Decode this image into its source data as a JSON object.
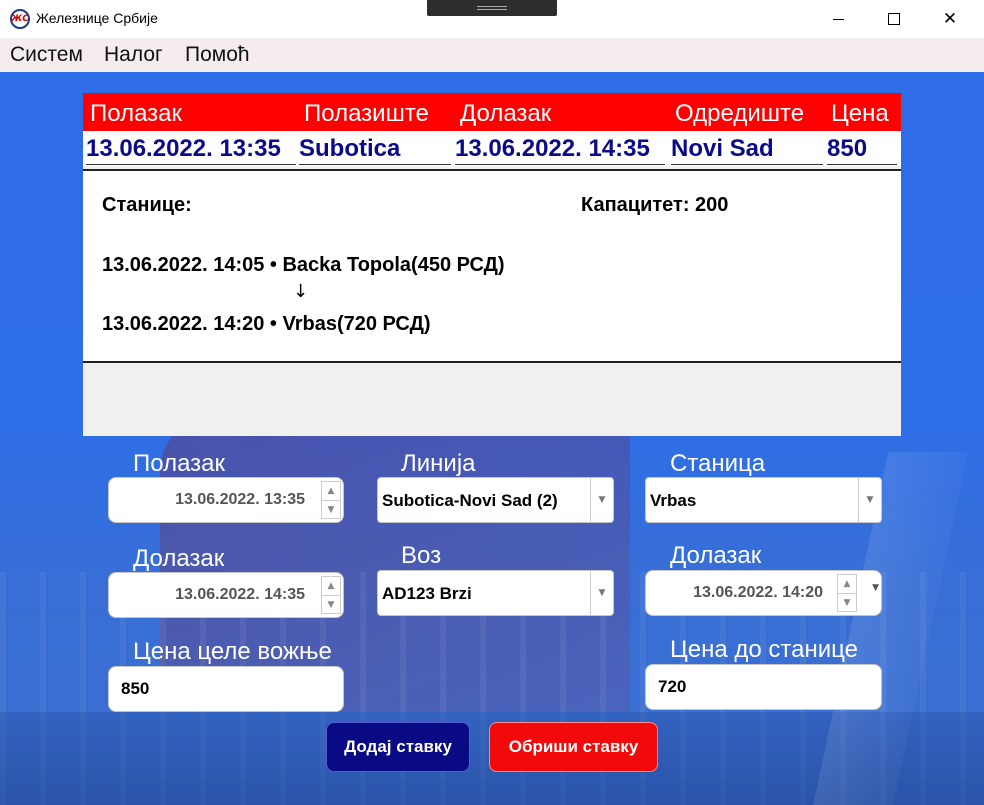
{
  "window": {
    "title": "Железнице Србије",
    "logo_text": "ЖС"
  },
  "menu": {
    "items": [
      "Систем",
      "Налог",
      "Помоћ"
    ]
  },
  "grid": {
    "headers": [
      "Полазак",
      "Полазиште",
      "Долазак",
      "Одредиште",
      "Цена"
    ],
    "row": {
      "departure": "13.06.2022. 13:35",
      "origin": "Subotica",
      "arrival": "13.06.2022. 14:35",
      "destination": "Novi Sad",
      "price": "850"
    }
  },
  "details": {
    "stations_label": "Станице:",
    "capacity": "Капацитет: 200",
    "stops": [
      "13.06.2022. 14:05 • Backa Topola(450 РСД)",
      "13.06.2022. 14:20 • Vrbas(720 РСД)"
    ],
    "arrow": "↓"
  },
  "form": {
    "departure_label": "Полазак",
    "departure_value": "13.06.2022. 13:35",
    "arrival_label": "Долазак",
    "arrival_value": "13.06.2022. 14:35",
    "full_price_label": "Цена целе вожње",
    "full_price_value": "850",
    "line_label": "Линија",
    "line_value": "Subotica-Novi Sad (2)",
    "train_label": "Воз",
    "train_value": "AD123 Brzi",
    "station_label": "Станица",
    "station_value": "Vrbas",
    "station_arrival_label": "Долазак",
    "station_arrival_value": "13.06.2022. 14:20",
    "station_price_label": "Цена до станице",
    "station_price_value": "720"
  },
  "buttons": {
    "add": "Додај ставку",
    "delete": "Обриши ставку"
  },
  "colors": {
    "header_red": "#ff0000",
    "row_text_blue": "#0a0a8a",
    "background_blue": "#2f6ee6",
    "add_button": "#0a0a84",
    "delete_button": "#f20a0a"
  },
  "icons": {
    "spin_up": "▲",
    "spin_down": "▼",
    "dropdown": "▼",
    "close": "✕"
  }
}
